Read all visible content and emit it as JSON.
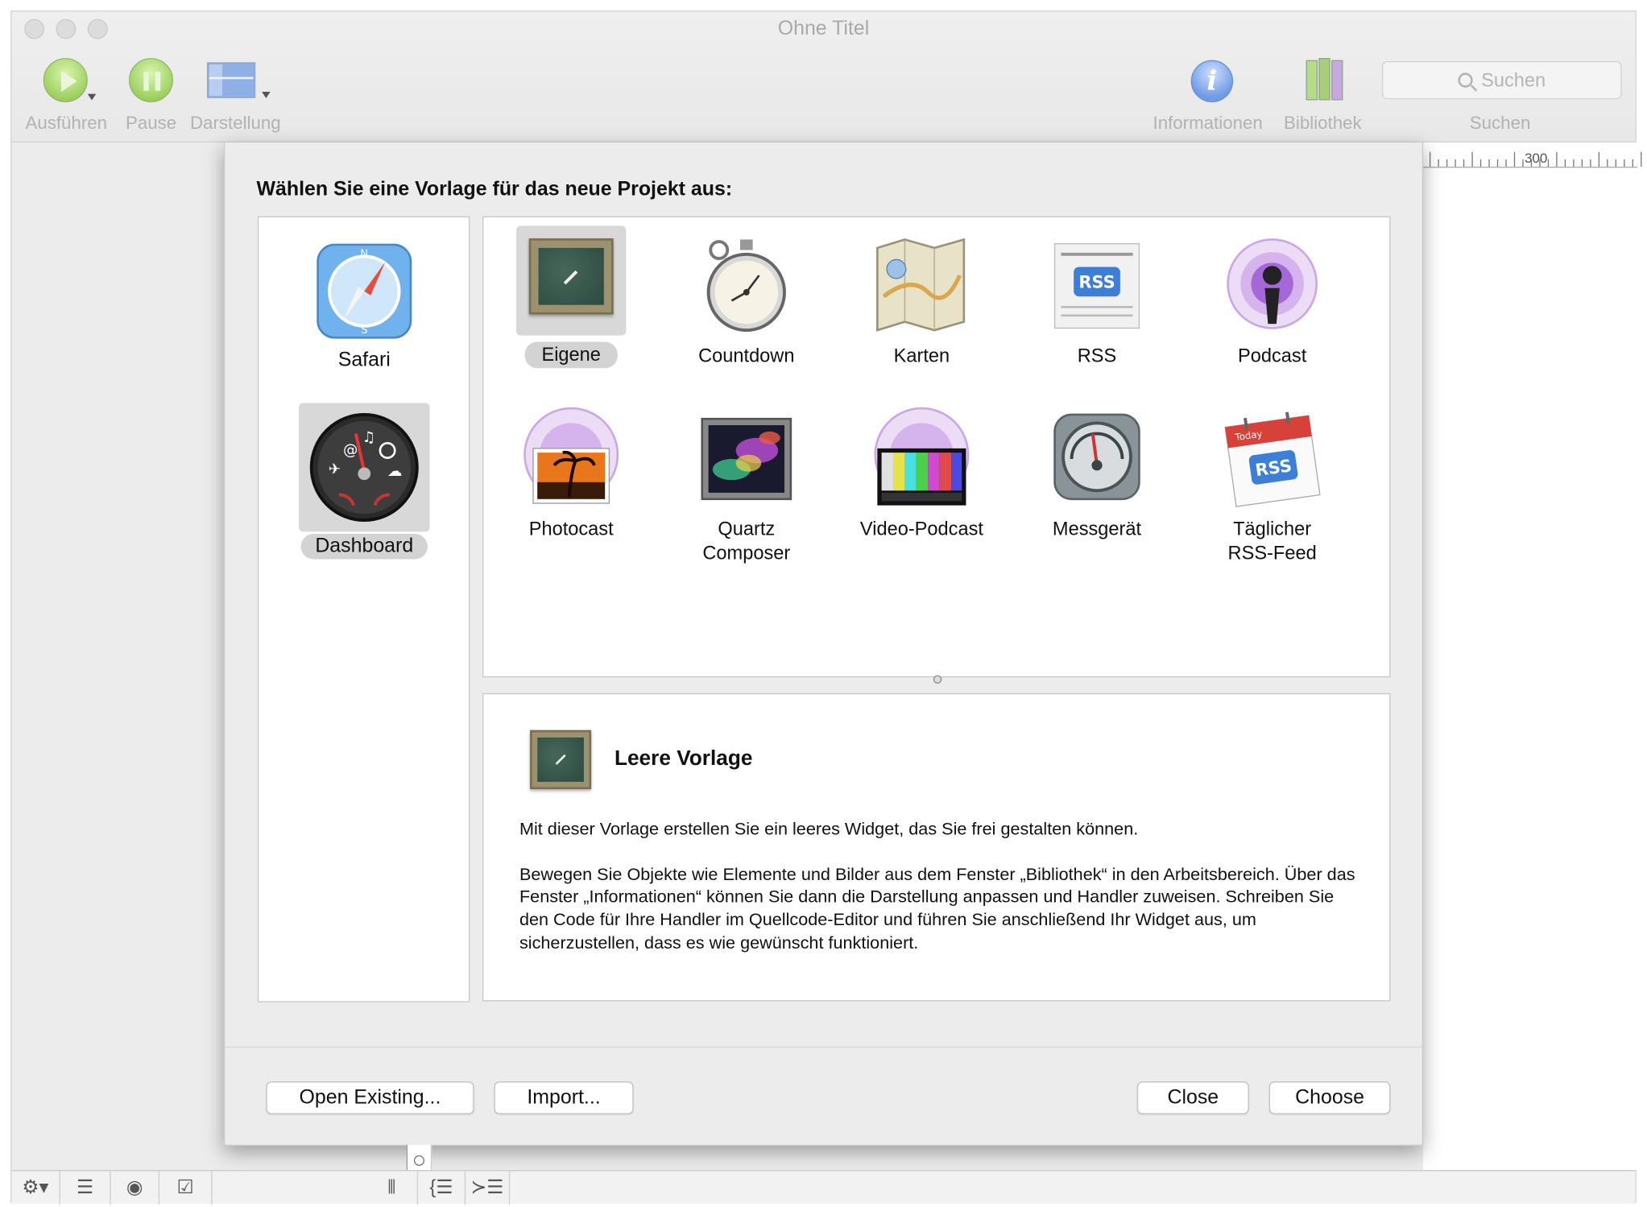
{
  "window": {
    "title": "Ohne Titel"
  },
  "toolbar": {
    "run_label": "Ausführen",
    "pause_label": "Pause",
    "view_label": "Darstellung",
    "info_label": "Informationen",
    "library_label": "Bibliothek",
    "search_placeholder": "Suchen",
    "search_label": "Suchen"
  },
  "ruler": {
    "mark": "300"
  },
  "dialog": {
    "heading": "Wählen Sie eine Vorlage für das neue Projekt aus:",
    "categories": [
      {
        "label": "Safari",
        "icon": "safari-compass-icon",
        "selected": false
      },
      {
        "label": "Dashboard",
        "icon": "dashboard-gauge-icon",
        "selected": true
      }
    ],
    "templates": [
      {
        "label": "Eigene",
        "icon": "chalkboard-icon",
        "selected": true
      },
      {
        "label": "Countdown",
        "icon": "stopwatch-icon",
        "selected": false
      },
      {
        "label": "Karten",
        "icon": "map-icon",
        "selected": false
      },
      {
        "label": "RSS",
        "icon": "rss-newspaper-icon",
        "selected": false
      },
      {
        "label": "Podcast",
        "icon": "podcast-icon",
        "selected": false
      },
      {
        "label": "Photocast",
        "icon": "photocast-icon",
        "selected": false
      },
      {
        "label": "Quartz Composer",
        "icon": "quartz-composer-icon",
        "selected": false
      },
      {
        "label": "Video-Podcast",
        "icon": "video-podcast-icon",
        "selected": false
      },
      {
        "label": "Messgerät",
        "icon": "gauge-meter-icon",
        "selected": false
      },
      {
        "label": "Täglicher RSS-Feed",
        "icon": "calendar-rss-icon",
        "selected": false
      }
    ],
    "description": {
      "title": "Leere Vorlage",
      "paragraph1": "Mit dieser Vorlage erstellen Sie ein leeres Widget, das Sie frei gestalten können.",
      "paragraph2": "Bewegen Sie Objekte wie Elemente und Bilder aus dem Fenster „Bibliothek“ in den Arbeitsbereich. Über das Fenster „Informationen“ können Sie dann die Darstellung anpassen und Handler zuweisen. Schreiben Sie den Code für Ihre Handler im Quellcode-Editor und führen Sie anschließend Ihr Widget aus, um sicherzustellen, dass es wie gewünscht funktioniert."
    },
    "buttons": {
      "open_existing": "Open Existing...",
      "import": "Import...",
      "close": "Close",
      "choose": "Choose"
    }
  },
  "bottombar": {
    "icons": [
      "gear-menu-icon",
      "list-icon",
      "record-icon",
      "checkbox-edit-icon",
      "column-icon",
      "indent-left-icon",
      "indent-right-icon"
    ]
  },
  "colors": {
    "window_bg": "#ececec",
    "selection": "#d3d3d3",
    "run_green": "#9fd060",
    "info_blue": "#6f9be4"
  }
}
